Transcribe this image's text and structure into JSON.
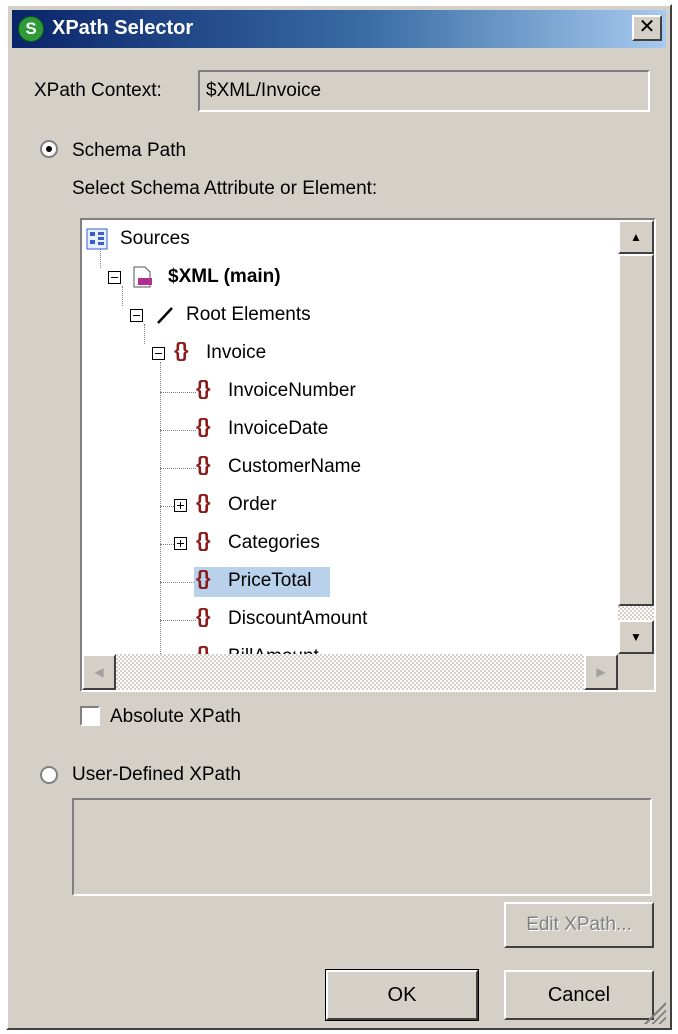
{
  "window": {
    "title": "XPath Selector",
    "app_icon_glyph": "S",
    "close_glyph": "✕"
  },
  "context": {
    "label": "XPath Context:",
    "value": "$XML/Invoice"
  },
  "schema_path": {
    "label": "Schema Path",
    "checked": true,
    "select_label": "Select Schema Attribute or Element:"
  },
  "tree": {
    "items": [
      {
        "label": "Sources",
        "icon": "sources-icon"
      },
      {
        "label": "$XML (main)",
        "icon": "xml-file-icon",
        "expanded": true
      },
      {
        "label": "Root Elements",
        "icon": "root-elements-icon",
        "expanded": true
      },
      {
        "label": "Invoice",
        "icon": "element-icon",
        "expanded": true
      },
      {
        "label": "InvoiceNumber",
        "icon": "element-icon"
      },
      {
        "label": "InvoiceDate",
        "icon": "element-icon"
      },
      {
        "label": "CustomerName",
        "icon": "element-icon"
      },
      {
        "label": "Order",
        "icon": "element-icon",
        "expanded": false
      },
      {
        "label": "Categories",
        "icon": "element-icon",
        "expanded": false
      },
      {
        "label": "PriceTotal",
        "icon": "element-icon",
        "selected": true
      },
      {
        "label": "DiscountAmount",
        "icon": "element-icon"
      },
      {
        "label": "BillAmount",
        "icon": "element-icon"
      }
    ],
    "braces_glyph": "{}"
  },
  "absolute_xpath": {
    "label": "Absolute XPath",
    "checked": false
  },
  "user_defined": {
    "label": "User-Defined XPath",
    "checked": false,
    "value": ""
  },
  "buttons": {
    "edit_xpath": "Edit XPath...",
    "ok": "OK",
    "cancel": "Cancel"
  },
  "colors": {
    "selection": "#b9d1ea",
    "element_icon": "#8b1a1a",
    "title_gradient_start": "#0a246a",
    "title_gradient_end": "#a6caf0",
    "dialog_face": "#d4d0c8"
  }
}
